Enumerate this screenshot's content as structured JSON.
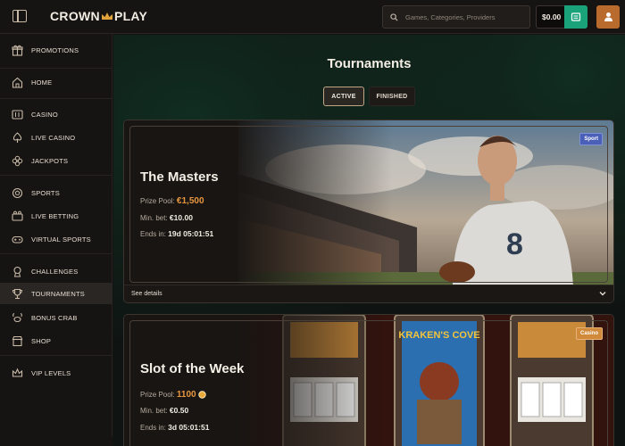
{
  "brand": {
    "name_left": "CROWN",
    "name_right": "PLAY"
  },
  "header": {
    "search_placeholder": "Games, Categories, Providers",
    "balance": "$0.00"
  },
  "sidebar": {
    "items": [
      {
        "label": "PROMOTIONS",
        "icon": "gift-icon"
      },
      {
        "label": "HOME",
        "icon": "home-icon"
      },
      {
        "label": "CASINO",
        "icon": "slot-machine-icon"
      },
      {
        "label": "LIVE CASINO",
        "icon": "spade-icon"
      },
      {
        "label": "JACKPOTS",
        "icon": "clover-icon"
      },
      {
        "label": "SPORTS",
        "icon": "ball-icon"
      },
      {
        "label": "LIVE BETTING",
        "icon": "live-betting-icon"
      },
      {
        "label": "VIRTUAL SPORTS",
        "icon": "gamepad-icon"
      },
      {
        "label": "CHALLENGES",
        "icon": "medal-icon"
      },
      {
        "label": "TOURNAMENTS",
        "icon": "trophy-icon"
      },
      {
        "label": "BONUS CRAB",
        "icon": "crab-icon"
      },
      {
        "label": "SHOP",
        "icon": "shop-icon"
      },
      {
        "label": "VIP LEVELS",
        "icon": "crown-icon"
      }
    ]
  },
  "main": {
    "title": "Tournaments",
    "tabs": {
      "active": "ACTIVE",
      "finished": "FINISHED"
    },
    "cards": [
      {
        "title": "The Masters",
        "badge": "Sport",
        "prize_label": "Prize Pool:",
        "prize_value": "€1,500",
        "min_bet_label": "Min. bet:",
        "min_bet_value": "€10.00",
        "ends_label": "Ends in:",
        "ends_value": "19d 05:01:51",
        "details": "See details"
      },
      {
        "title": "Slot of the Week",
        "badge": "Casino",
        "prize_label": "Prize Pool:",
        "prize_value": "1100",
        "min_bet_label": "Min. bet:",
        "min_bet_value": "€0.50",
        "ends_label": "Ends in:",
        "ends_value": "3d 05:01:51",
        "slot_marquee": "KRAKEN'S COVE"
      }
    ]
  },
  "colors": {
    "accent_orange": "#e8963f",
    "wallet_green": "#1aa37a",
    "profile_orange": "#b86b2c",
    "sport_badge": "#4a5fb8",
    "casino_badge": "#d08a3a"
  }
}
